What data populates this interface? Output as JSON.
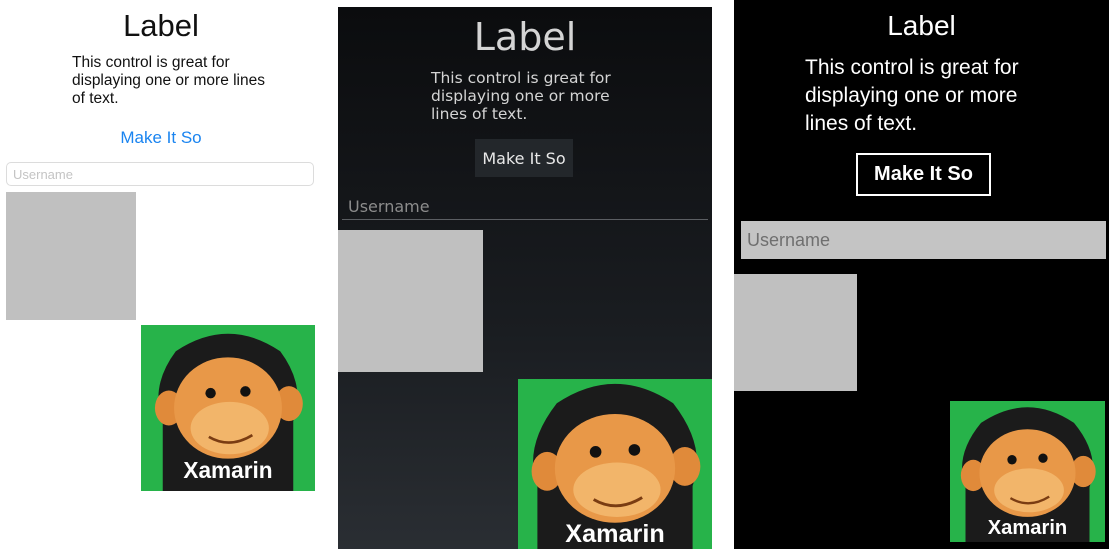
{
  "panels": [
    {
      "platform": "ios",
      "label": "Label",
      "description": "This control is great for displaying one or more lines of text.",
      "button": "Make It So",
      "username_placeholder": "Username",
      "image_caption": "Xamarin",
      "accent": "#1a84f0"
    },
    {
      "platform": "android",
      "label": "Label",
      "description": "This control is great for displaying one or more lines of text.",
      "button": "Make It So",
      "username_placeholder": "Username",
      "image_caption": "Xamarin"
    },
    {
      "platform": "windows-phone",
      "label": "Label",
      "description": "This control is great for displaying one or more lines of text.",
      "button": "Make It So",
      "username_placeholder": "Username",
      "image_caption": "Xamarin"
    }
  ],
  "colors": {
    "box_gray": "#c0c0c0",
    "image_background": "#27b34a"
  },
  "icons": {
    "image": "monkey-image"
  }
}
